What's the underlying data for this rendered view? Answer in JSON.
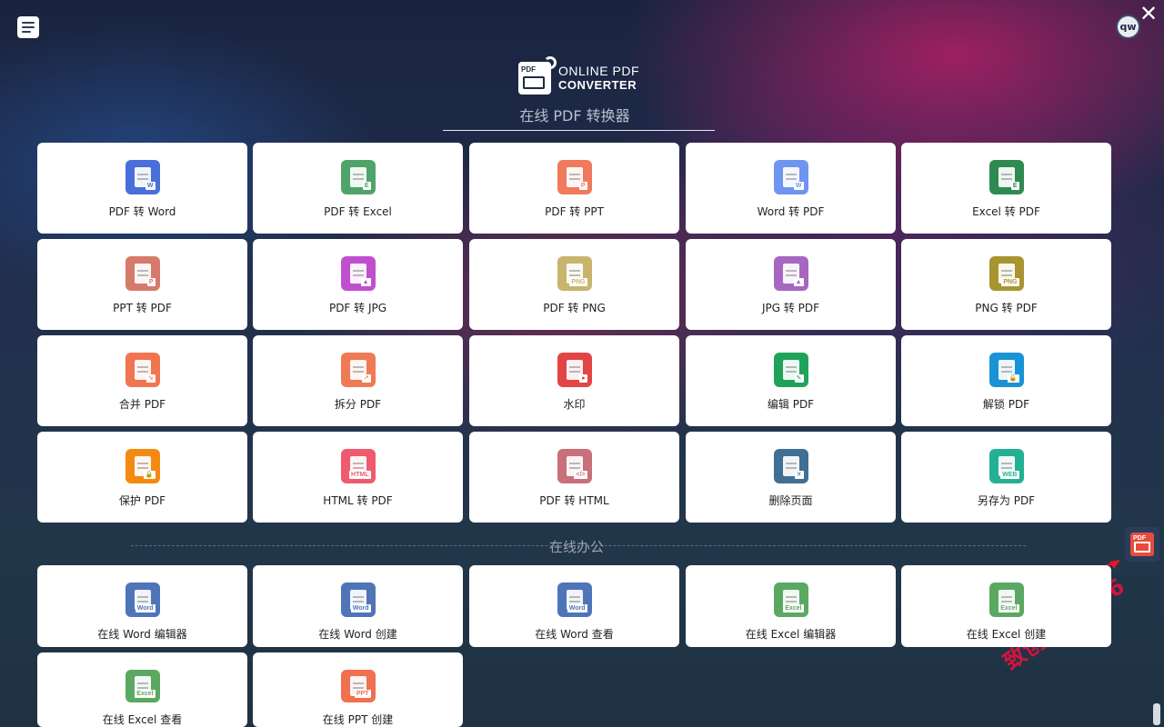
{
  "app": {
    "brand_line1": "ONLINE PDF",
    "brand_line2": "CONVERTER",
    "brand_logo_tag": "PDF",
    "subtitle": "在线 PDF 转换器",
    "avatar_text": "qw",
    "close_glyph": "✕"
  },
  "tools": [
    {
      "label": "PDF 转 Word",
      "icon": "pdf-to-word-icon",
      "color": "#4a6fd8",
      "glyph": "W"
    },
    {
      "label": "PDF 转 Excel",
      "icon": "pdf-to-excel-icon",
      "color": "#4fa46a",
      "glyph": "E"
    },
    {
      "label": "PDF 转 PPT",
      "icon": "pdf-to-ppt-icon",
      "color": "#f07a5c",
      "glyph": "P"
    },
    {
      "label": "Word 转 PDF",
      "icon": "word-to-pdf-icon",
      "color": "#6f95f0",
      "glyph": "W"
    },
    {
      "label": "Excel 转 PDF",
      "icon": "excel-to-pdf-icon",
      "color": "#2f8a52",
      "glyph": "E"
    },
    {
      "label": "PPT 转 PDF",
      "icon": "ppt-to-pdf-icon",
      "color": "#d67a6c",
      "glyph": "P"
    },
    {
      "label": "PDF 转 JPG",
      "icon": "pdf-to-jpg-icon",
      "color": "#c04fd0",
      "glyph": "▲"
    },
    {
      "label": "PDF 转 PNG",
      "icon": "pdf-to-png-icon",
      "color": "#c9b46e",
      "glyph": "PNG"
    },
    {
      "label": "JPG 转 PDF",
      "icon": "jpg-to-pdf-icon",
      "color": "#a567c2",
      "glyph": "▲"
    },
    {
      "label": "PNG 转 PDF",
      "icon": "png-to-pdf-icon",
      "color": "#a89530",
      "glyph": "PNG"
    },
    {
      "label": "合并 PDF",
      "icon": "merge-pdf-icon",
      "color": "#f07550",
      "glyph": "↘"
    },
    {
      "label": "拆分 PDF",
      "icon": "split-pdf-icon",
      "color": "#ef7a55",
      "glyph": "↗"
    },
    {
      "label": "水印",
      "icon": "watermark-stamp-icon",
      "color": "#e24545",
      "glyph": "●"
    },
    {
      "label": "编辑 PDF",
      "icon": "edit-pdf-icon",
      "color": "#1fa35a",
      "glyph": "✎"
    },
    {
      "label": "解锁 PDF",
      "icon": "unlock-pdf-icon",
      "color": "#1a92d6",
      "glyph": "🔓"
    },
    {
      "label": "保护 PDF",
      "icon": "protect-pdf-icon",
      "color": "#f58a12",
      "glyph": "🔒"
    },
    {
      "label": "HTML 转 PDF",
      "icon": "html-to-pdf-icon",
      "color": "#ef5a6e",
      "glyph": "HTML"
    },
    {
      "label": "PDF 转 HTML",
      "icon": "pdf-to-html-icon",
      "color": "#c9707a",
      "glyph": "</>"
    },
    {
      "label": "删除页面",
      "icon": "delete-page-icon",
      "color": "#3f6f94",
      "glyph": "✕"
    },
    {
      "label": "另存为 PDF",
      "icon": "save-as-pdf-icon",
      "color": "#24b193",
      "glyph": "WEB"
    }
  ],
  "office_section_title": "在线办公",
  "office_tools": [
    {
      "label": "在线 Word 编辑器",
      "icon": "word-editor-icon",
      "color": "#4f74b8",
      "glyph": "Word"
    },
    {
      "label": "在线 Word 创建",
      "icon": "word-create-icon",
      "color": "#4f74b8",
      "glyph": "Word"
    },
    {
      "label": "在线 Word 查看",
      "icon": "word-view-icon",
      "color": "#4f74b8",
      "glyph": "Word"
    },
    {
      "label": "在线 Excel 编辑器",
      "icon": "excel-editor-icon",
      "color": "#5aa862",
      "glyph": "Excel"
    },
    {
      "label": "在线 Excel 创建",
      "icon": "excel-create-icon",
      "color": "#5aa862",
      "glyph": "Excel"
    },
    {
      "label": "在线 Excel 查看",
      "icon": "excel-view-icon",
      "color": "#5aa862",
      "glyph": "Excel"
    },
    {
      "label": "在线 PPT 创建",
      "icon": "ppt-create-icon",
      "color": "#f07050",
      "glyph": "PPT"
    }
  ],
  "side_float_tag": "PDF",
  "watermark_text": "致创社scs66"
}
